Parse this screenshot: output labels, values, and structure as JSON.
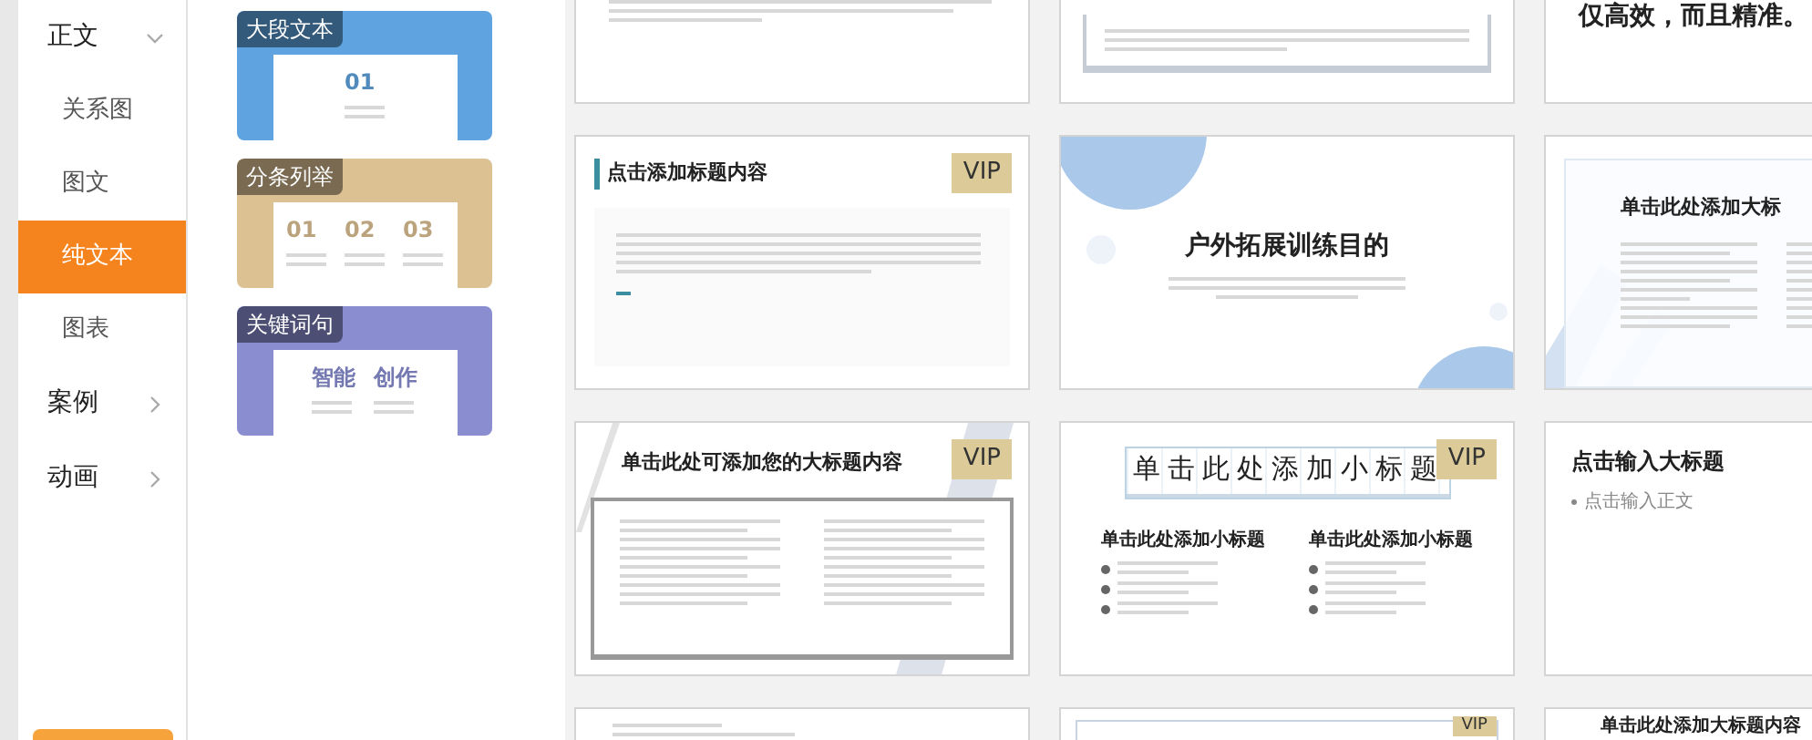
{
  "sidebar": {
    "items": [
      {
        "label": "正文",
        "kind": "group",
        "expanded": true,
        "selected": false
      },
      {
        "label": "关系图",
        "kind": "sub",
        "selected": false
      },
      {
        "label": "图文",
        "kind": "sub",
        "selected": false
      },
      {
        "label": "纯文本",
        "kind": "sub",
        "selected": true
      },
      {
        "label": "图表",
        "kind": "sub",
        "selected": false
      },
      {
        "label": "案例",
        "kind": "group",
        "expanded": false,
        "selected": false
      },
      {
        "label": "动画",
        "kind": "group",
        "expanded": false,
        "selected": false
      }
    ]
  },
  "categories": [
    {
      "label": "大段文本",
      "color": "#5fa3e0",
      "items": [
        "01"
      ]
    },
    {
      "label": "分条列举",
      "color": "#dcc193",
      "items": [
        "01",
        "02",
        "03"
      ]
    },
    {
      "label": "关键词句",
      "color": "#8a8ed1",
      "items": [
        "智能",
        "创作"
      ]
    }
  ],
  "templates": [
    {
      "kind": "bullets-tail"
    },
    {
      "kind": "framed-tail"
    },
    {
      "kind": "caption-tail",
      "title": "仅高效，而且精准。"
    },
    {
      "kind": "boxed-title",
      "title": "点击添加标题内容",
      "badge": "VIP"
    },
    {
      "kind": "circles",
      "title": "户外拓展训练目的"
    },
    {
      "kind": "diagonal",
      "title": "单击此处添加大标"
    },
    {
      "kind": "two-col",
      "title": "单击此处可添加您的大标题内容",
      "badge": "VIP"
    },
    {
      "kind": "grid-title",
      "title": "单击此处添加小标题",
      "subtitles": [
        "单击此处添加小标题",
        "单击此处添加小标题"
      ],
      "badge": "VIP"
    },
    {
      "kind": "plain",
      "title": "点击输入大标题",
      "body": "点击输入正文"
    },
    {
      "kind": "top-lines"
    },
    {
      "kind": "framed-top",
      "badge": "VIP"
    },
    {
      "kind": "title-top",
      "title": "单击此处添加大标题内容"
    }
  ]
}
